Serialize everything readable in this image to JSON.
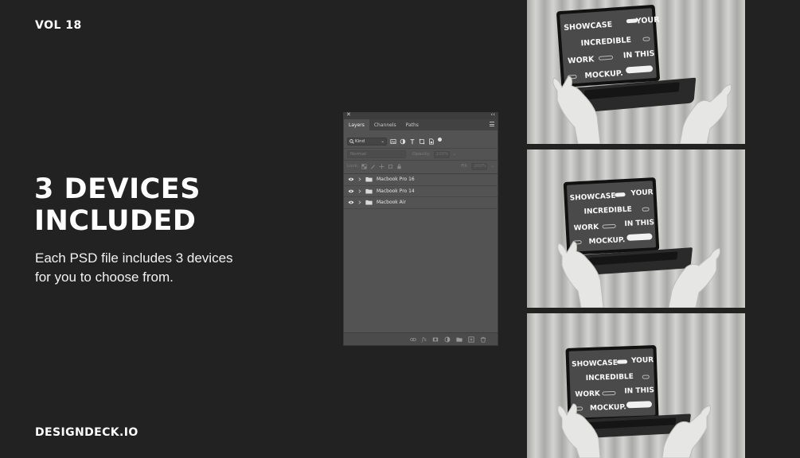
{
  "header": {
    "volume": "VOL 18"
  },
  "hero": {
    "headline_line1": "3 DEVICES",
    "headline_line2": "INCLUDED",
    "subtext_line1": "Each PSD file includes 3 devices",
    "subtext_line2": "for you to choose from."
  },
  "footer": {
    "brand": "DESIGNDECK.IO"
  },
  "layers_panel": {
    "tabs": [
      "Layers",
      "Channels",
      "Paths"
    ],
    "active_tab": "Layers",
    "filter_kind": "Kind",
    "blend_mode": "Normal",
    "opacity_label": "Opacity:",
    "opacity_value": "100%",
    "lock_label": "Lock:",
    "fill_label": "Fill:",
    "fill_value": "100%",
    "layers": [
      {
        "name": "Macbook Pro 16"
      },
      {
        "name": "Macbook Pro 14"
      },
      {
        "name": "Macbook Air"
      }
    ],
    "icons": [
      "close-icon",
      "collapse-icon",
      "panel-menu-icon",
      "search-icon",
      "image-filter-icon",
      "adjustment-filter-icon",
      "type-filter-icon",
      "shape-filter-icon",
      "smart-object-filter-icon",
      "eye-icon",
      "chevron-right-icon",
      "folder-icon",
      "link-icon",
      "fx-icon",
      "mask-icon",
      "adjustment-icon",
      "group-icon",
      "new-layer-icon",
      "trash-icon"
    ]
  },
  "screen_copy": {
    "w1": "SHOWCASE",
    "w2": "YOUR",
    "w3": "INCREDIBLE",
    "w4": "WORK",
    "w5": "IN THIS",
    "w6": "MOCKUP."
  }
}
